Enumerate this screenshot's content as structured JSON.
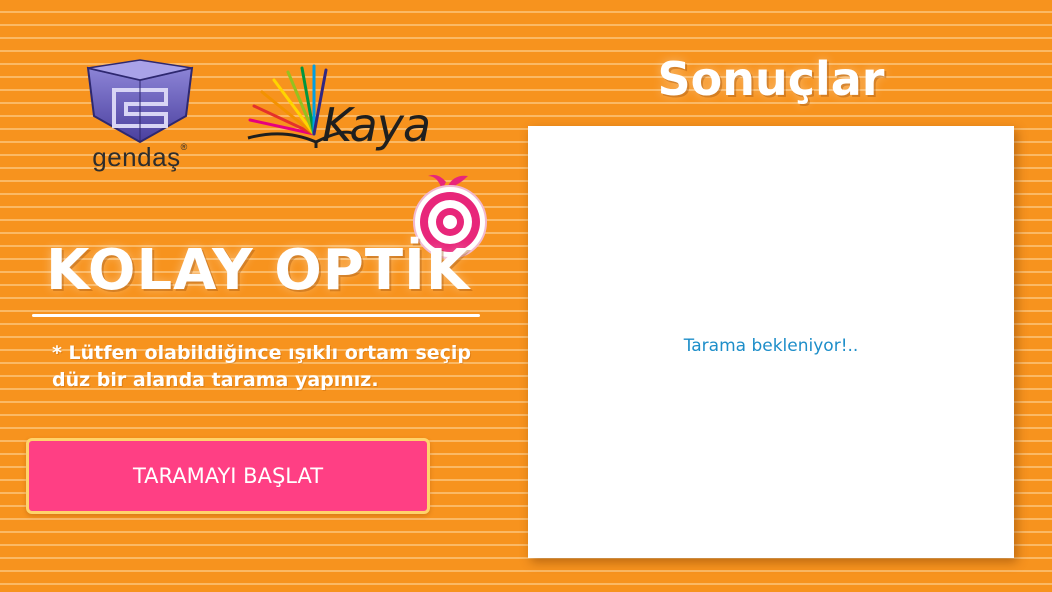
{
  "logos": {
    "gendas": {
      "name": "gendaş",
      "registered": "®"
    },
    "kaya": {
      "name": "Kaya"
    }
  },
  "app": {
    "title": "KOLAY OPTİK"
  },
  "instruction": "* Lütfen olabildiğince ışıklı ortam seçip düz bir alanda tarama yapınız.",
  "start_button": {
    "label": "TARAMAYI BAŞLAT"
  },
  "results": {
    "title": "Sonuçlar",
    "status": "Tarama bekleniyor!.."
  },
  "colors": {
    "background": "#f7931e",
    "stripe": "#fbb965",
    "button": "#ff3f84",
    "button_border": "#ffd36b",
    "status_text": "#1d8ec9",
    "target": "#e8267a"
  },
  "icons": {
    "gendas": "gendas-logo-icon",
    "kaya": "kaya-book-rays-icon",
    "target": "apple-target-icon"
  }
}
